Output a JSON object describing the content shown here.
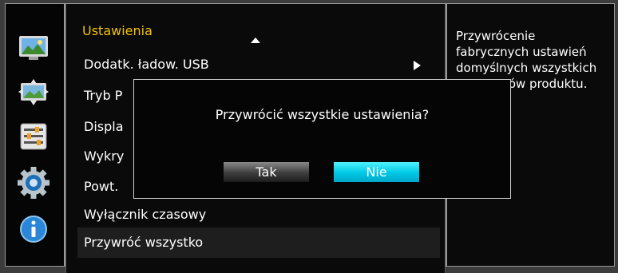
{
  "sidebar": {
    "icons": [
      {
        "name": "picture-icon"
      },
      {
        "name": "screen-adjust-icon"
      },
      {
        "name": "sliders-icon"
      },
      {
        "name": "settings-gear-icon"
      },
      {
        "name": "info-icon"
      }
    ]
  },
  "menu": {
    "title": "Ustawienia",
    "items": [
      {
        "label": "Dodatk. ładow. USB"
      },
      {
        "label": "Tryb P"
      },
      {
        "label": "Displa"
      },
      {
        "label": "Wykry"
      },
      {
        "label": "Powt."
      },
      {
        "label": "Wyłącznik czasowy"
      },
      {
        "label": "Przywróć wszystko"
      }
    ]
  },
  "description": {
    "line1": "Przywrócenie",
    "line2": "fabrycznych ustawień",
    "line3": "domyślnych wszystkich",
    "line4": "rów produktu."
  },
  "dialog": {
    "message": "Przywrócić wszystkie ustawienia?",
    "yes_label": "Tak",
    "no_label": "Nie"
  },
  "colors": {
    "title": "#f2c200",
    "focus": "#00c8e6"
  }
}
